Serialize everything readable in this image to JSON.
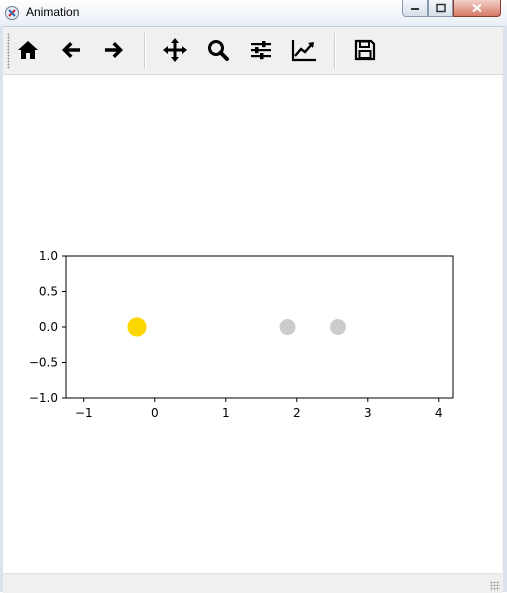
{
  "window": {
    "title": "Animation"
  },
  "toolbar": {
    "buttons": [
      {
        "name": "home",
        "icon": "home-icon"
      },
      {
        "name": "back",
        "icon": "arrow-left-icon"
      },
      {
        "name": "forward",
        "icon": "arrow-right-icon"
      },
      {
        "name": "pan",
        "icon": "move-icon"
      },
      {
        "name": "zoom",
        "icon": "search-icon"
      },
      {
        "name": "configure-subplots",
        "icon": "sliders-icon"
      },
      {
        "name": "edit-axes",
        "icon": "chart-line-icon"
      },
      {
        "name": "save",
        "icon": "floppy-disk-icon"
      }
    ]
  },
  "chart_data": {
    "type": "scatter",
    "xlim": [
      -1.25,
      4.2
    ],
    "ylim": [
      -1.0,
      1.0
    ],
    "xticks": [
      -1,
      0,
      1,
      2,
      3,
      4
    ],
    "yticks": [
      1.0,
      0.5,
      0.0,
      -0.5,
      -1.0
    ],
    "xtick_labels": [
      "−1",
      "0",
      "1",
      "2",
      "3",
      "4"
    ],
    "ytick_labels": [
      "1.0",
      "0.5",
      "0.0",
      "−0.5",
      "−1.0"
    ],
    "points": [
      {
        "x": -0.25,
        "y": 0.0,
        "r": 0.36,
        "color": "#FFD700"
      },
      {
        "x": 1.87,
        "y": 0.0,
        "r": 0.3,
        "color": "#CCCCCC"
      },
      {
        "x": 2.58,
        "y": 0.0,
        "r": 0.3,
        "color": "#CCCCCC"
      }
    ],
    "grid": false
  },
  "colors": {
    "gold": "#FFD700",
    "grey": "#CCCCCC"
  }
}
